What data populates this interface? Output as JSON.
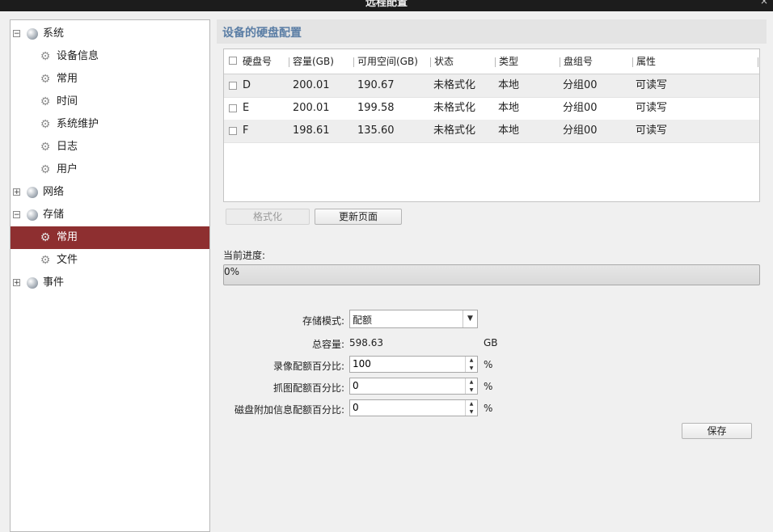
{
  "window": {
    "title": "远程配置",
    "close_symbol": "×"
  },
  "sidebar": {
    "groups": [
      {
        "label": "系统",
        "expanded_symbol": "−"
      },
      {
        "label": "网络",
        "expanded_symbol": "+"
      },
      {
        "label": "存储",
        "expanded_symbol": "−"
      },
      {
        "label": "事件",
        "expanded_symbol": "+"
      }
    ],
    "system_items": [
      "设备信息",
      "常用",
      "时间",
      "系统维护",
      "日志",
      "用户"
    ],
    "storage_items": [
      "常用",
      "文件"
    ]
  },
  "main": {
    "title": "设备的硬盘配置",
    "table": {
      "headers": [
        "硬盘号",
        "容量(GB)",
        "可用空间(GB)",
        "状态",
        "类型",
        "盘组号",
        "属性"
      ],
      "rows": [
        [
          "D",
          "200.01",
          "190.67",
          "未格式化",
          "本地",
          "分组00",
          "可读写"
        ],
        [
          "E",
          "200.01",
          "199.58",
          "未格式化",
          "本地",
          "分组00",
          "可读写"
        ],
        [
          "F",
          "198.61",
          "135.60",
          "未格式化",
          "本地",
          "分组00",
          "可读写"
        ]
      ]
    },
    "buttons": {
      "format": "格式化",
      "refresh": "更新页面",
      "save": "保存"
    },
    "progress": {
      "label": "当前进度:",
      "text": "0%",
      "value": 0
    },
    "form": {
      "storage_mode_label": "存储模式:",
      "storage_mode_value": "配额",
      "total_capacity_label": "总容量:",
      "total_capacity_value": "598.63",
      "total_capacity_unit": "GB",
      "record_quota_label": "录像配额百分比:",
      "record_quota_value": "100",
      "capture_quota_label": "抓图配额百分比:",
      "capture_quota_value": "0",
      "extra_quota_label": "磁盘附加信息配额百分比:",
      "extra_quota_value": "0",
      "percent_unit": "%"
    }
  },
  "colors": {
    "selection": "#8e2f30",
    "header_text": "#5b7ea5"
  }
}
